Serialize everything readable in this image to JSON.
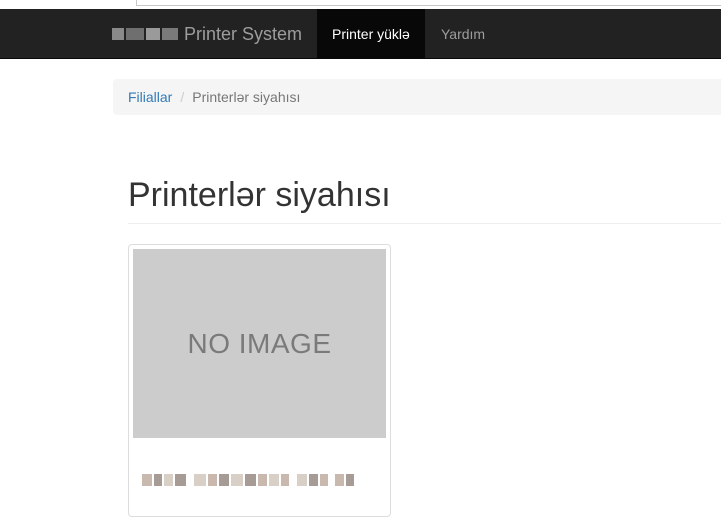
{
  "navbar": {
    "brand": "Printer System",
    "items": [
      {
        "label": "Printer yüklə",
        "active": true
      },
      {
        "label": "Yardım",
        "active": false
      }
    ]
  },
  "breadcrumb": {
    "items": [
      "Filiallar",
      "Printerlər siyahısı"
    ],
    "separator": "/"
  },
  "page": {
    "title": "Printerlər siyahısı"
  },
  "printers": [
    {
      "image_placeholder": "NO IMAGE",
      "name": ""
    }
  ],
  "colors": {
    "navbar_bg": "#222222",
    "navbar_active_bg": "#080808",
    "link": "#337ab7",
    "breadcrumb_bg": "#f5f5f5",
    "placeholder_bg": "#cccccc"
  }
}
